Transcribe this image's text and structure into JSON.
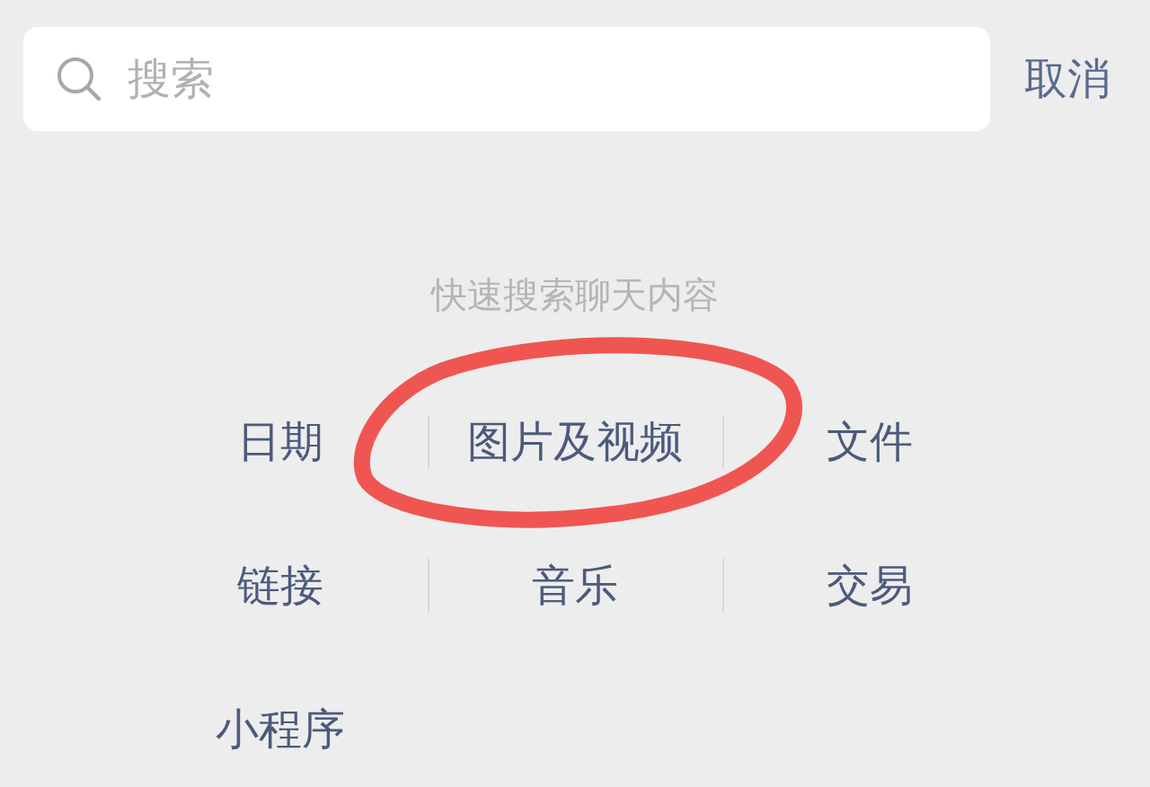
{
  "search": {
    "placeholder": "搜索"
  },
  "cancel": "取消",
  "hint": "快速搜索聊天内容",
  "categories": [
    {
      "label": "日期",
      "highlighted": false
    },
    {
      "label": "图片及视频",
      "highlighted": true
    },
    {
      "label": "文件",
      "highlighted": false
    },
    {
      "label": "链接",
      "highlighted": false
    },
    {
      "label": "音乐",
      "highlighted": false
    },
    {
      "label": "交易",
      "highlighted": false
    },
    {
      "label": "小程序",
      "highlighted": false
    }
  ]
}
